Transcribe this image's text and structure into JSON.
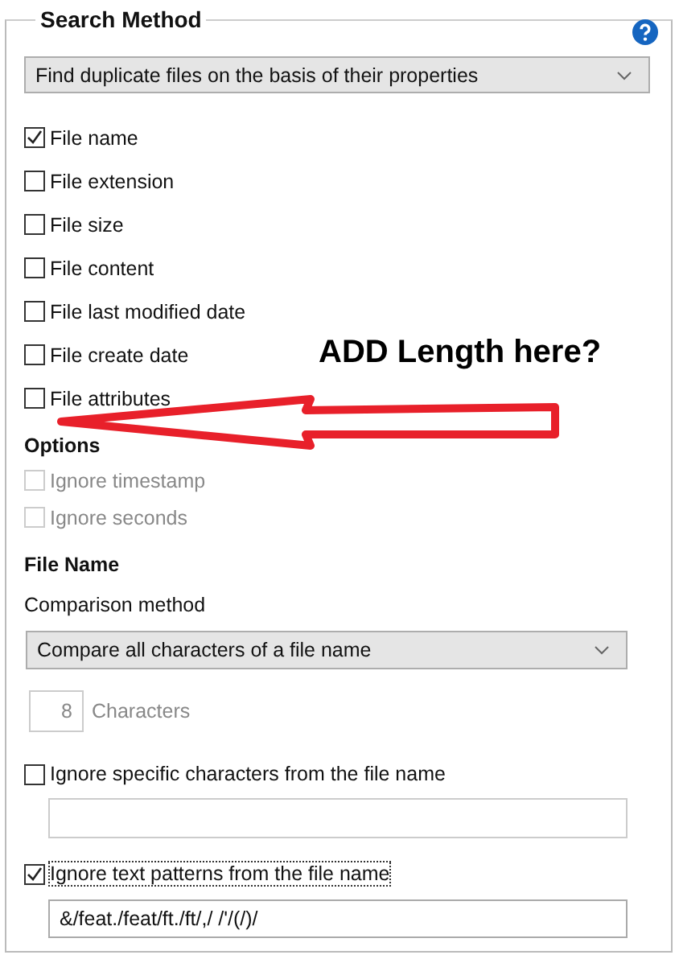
{
  "group": {
    "title": "Search Method"
  },
  "method_dropdown": {
    "value": "Find duplicate files on the basis of their properties"
  },
  "criteria": [
    {
      "label": "File name",
      "checked": true
    },
    {
      "label": "File extension",
      "checked": false
    },
    {
      "label": "File size",
      "checked": false
    },
    {
      "label": "File content",
      "checked": false
    },
    {
      "label": "File last modified date",
      "checked": false
    },
    {
      "label": "File create date",
      "checked": false
    },
    {
      "label": "File attributes",
      "checked": false
    }
  ],
  "options": {
    "title": "Options",
    "items": [
      {
        "label": "Ignore timestamp",
        "checked": false,
        "disabled": true
      },
      {
        "label": "Ignore seconds",
        "checked": false,
        "disabled": true
      }
    ]
  },
  "file_name": {
    "title": "File Name",
    "comparison_label": "Comparison method",
    "comparison_dropdown": {
      "value": "Compare all characters of a file name"
    },
    "characters": {
      "value": "8",
      "unit": "Characters",
      "disabled": true
    },
    "ignore_chars": {
      "label": "Ignore specific characters from the file name",
      "checked": false
    },
    "ignore_patterns": {
      "label": "Ignore text patterns from the file name",
      "checked": true,
      "focused": true,
      "value": "&/feat./feat/ft./ft/,/ /'/(/)/"
    }
  },
  "annotation": {
    "text": "ADD Length here?"
  }
}
